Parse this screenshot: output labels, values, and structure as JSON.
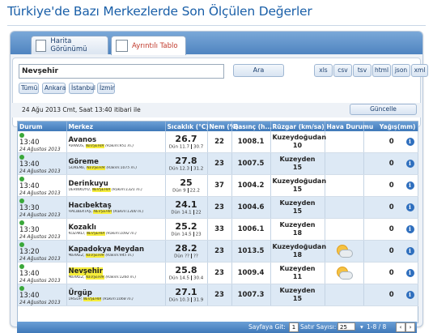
{
  "page": {
    "title": "Türkiye'de Bazı Merkezlerde Son Ölçülen Değerler"
  },
  "tabs": [
    {
      "label": "Harita Görünümü",
      "icon": "map-icon",
      "active": false
    },
    {
      "label": "Ayrıntılı Tablo",
      "icon": "table-icon",
      "active": true
    }
  ],
  "search": {
    "value": "Nevşehir",
    "button": "Ara"
  },
  "formats": [
    "xls",
    "csv",
    "tsv",
    "html",
    "json",
    "xml"
  ],
  "quick_filters": [
    "Tümü",
    "Ankara",
    "İstanbul",
    "İzmir"
  ],
  "info": {
    "text": "24 Ağu 2013 Cmt, Saat 13:40 itibari ile",
    "refresh": "Güncelle"
  },
  "columns": [
    "Durum",
    "Merkez",
    "Sıcaklık (°C)",
    "Nem (%)",
    "Basınç (h...",
    "Rüzgar (km/sa)",
    "Hava Durumu",
    "Yağış(mm)"
  ],
  "rows": [
    {
      "time": "13:40",
      "date": "24 Ağustos 2013",
      "name": "Avanos",
      "sub_pre": "AVANOS, ",
      "sub_hl": "NEVŞEHİR",
      "sub_post": " (Rakım:951 m.)",
      "temp": "26.7",
      "dun": "Dün",
      "min": "11.7",
      "max": "30.7",
      "nem": "22",
      "basinc": "1008.1",
      "wind_dir": "Kuzeydoğudan",
      "wind_speed": "10",
      "weather": "",
      "rain": "0",
      "name_hl": false
    },
    {
      "time": "13:40",
      "date": "24 Ağustos 2013",
      "name": "Göreme",
      "sub_pre": "GÖREME, ",
      "sub_hl": "NEVŞEHİR",
      "sub_post": " (Rakım:1075 m.)",
      "temp": "27.8",
      "dun": "Dün",
      "min": "12.3",
      "max": "31.2",
      "nem": "23",
      "basinc": "1007.5",
      "wind_dir": "Kuzeyden",
      "wind_speed": "15",
      "weather": "",
      "rain": "0",
      "name_hl": false
    },
    {
      "time": "13:40",
      "date": "24 Ağustos 2013",
      "name": "Derinkuyu",
      "sub_pre": "DERİNKUYU, ",
      "sub_hl": "NEVŞEHİR",
      "sub_post": " (Rakım:1321 m.)",
      "temp": "25",
      "dun": "Dün",
      "min": "9",
      "max": "22.2",
      "nem": "37",
      "basinc": "1004.2",
      "wind_dir": "Kuzeydoğudan",
      "wind_speed": "15",
      "weather": "",
      "rain": "0",
      "name_hl": false
    },
    {
      "time": "13:30",
      "date": "24 Ağustos 2013",
      "name": "Hacıbektaş",
      "sub_pre": "HACIBEKTAŞ, ",
      "sub_hl": "NEVŞEHİR",
      "sub_post": " (Rakım:1300 m.)",
      "temp": "24.1",
      "dun": "Dün",
      "min": "14.1",
      "max": "22",
      "nem": "23",
      "basinc": "1004.6",
      "wind_dir": "Kuzeyden",
      "wind_speed": "15",
      "weather": "",
      "rain": "0",
      "name_hl": false
    },
    {
      "time": "13:30",
      "date": "24 Ağustos 2013",
      "name": "Kozaklı",
      "sub_pre": "KOZAKLI, ",
      "sub_hl": "NEVŞEHİR",
      "sub_post": " (Rakım:1092 m.)",
      "temp": "25.2",
      "dun": "Dün",
      "min": "14.5",
      "max": "23",
      "nem": "33",
      "basinc": "1006.1",
      "wind_dir": "Kuzeyden",
      "wind_speed": "18",
      "weather": "",
      "rain": "0",
      "name_hl": false
    },
    {
      "time": "13:20",
      "date": "24 Ağustos 2013",
      "name": "Kapadokya Meydan",
      "sub_pre": "MERKEZ, ",
      "sub_hl": "NEVŞEHİR",
      "sub_post": " (Rakım:945 m.)",
      "temp": "28.2",
      "dun": "Dün",
      "min": "??",
      "max": "??",
      "nem": "23",
      "basinc": "1013.5",
      "wind_dir": "Kuzeydoğudan",
      "wind_speed": "18",
      "weather": "partly-cloudy-icon",
      "rain": "0",
      "name_hl": false
    },
    {
      "time": "13:40",
      "date": "24 Ağustos 2013",
      "name": "Nevşehir",
      "sub_pre": "MERKEZ, ",
      "sub_hl": "NEVŞEHİR",
      "sub_post": " (Rakım:1260 m.)",
      "temp": "25.8",
      "dun": "Dün",
      "min": "14.5",
      "max": "30.4",
      "nem": "23",
      "basinc": "1009.4",
      "wind_dir": "Kuzeyden",
      "wind_speed": "11",
      "weather": "partly-cloudy-icon",
      "rain": "0",
      "name_hl": true
    },
    {
      "time": "13:40",
      "date": "24 Ağustos 2013",
      "name": "Ürgüp",
      "sub_pre": "ÜRGÜP, ",
      "sub_hl": "NEVŞEHİR",
      "sub_post": " (Rakım:1068 m.)",
      "temp": "27.1",
      "dun": "Dün",
      "min": "10.3",
      "max": "31.9",
      "nem": "23",
      "basinc": "1007.3",
      "wind_dir": "Kuzeyden",
      "wind_speed": "15",
      "weather": "",
      "rain": "0",
      "name_hl": false
    }
  ],
  "pager": {
    "goto_label": "Sayfaya Git:",
    "page": "1",
    "rows_label": "Satır Sayısı:",
    "rows_value": "25",
    "range": "1-8 / 8"
  },
  "colors": {
    "accent": "#1a5fa8",
    "header": "#3f78b8",
    "highlight": "#f6ee3b",
    "status_ok": "#3aa83a"
  }
}
